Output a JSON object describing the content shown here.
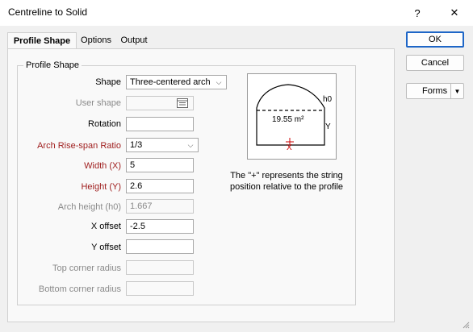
{
  "window": {
    "title": "Centreline to Solid",
    "help_icon": "?",
    "close_icon": "✕"
  },
  "tabs": [
    {
      "label": "Profile Shape"
    },
    {
      "label": "Options"
    },
    {
      "label": "Output"
    }
  ],
  "group": {
    "title": "Profile Shape"
  },
  "fields": {
    "shape": {
      "label": "Shape",
      "value": "Three-centered arch"
    },
    "user_shape": {
      "label": "User shape",
      "value": ""
    },
    "rotation": {
      "label": "Rotation",
      "value": ""
    },
    "arch_ratio": {
      "label": "Arch Rise-span Ratio",
      "value": "1/3"
    },
    "width": {
      "label": "Width (X)",
      "value": "5"
    },
    "height": {
      "label": "Height (Y)",
      "value": "2.6"
    },
    "arch_height": {
      "label": "Arch height (h0)",
      "value": "1.667"
    },
    "x_offset": {
      "label": "X offset",
      "value": "-2.5"
    },
    "y_offset": {
      "label": "Y offset",
      "value": ""
    },
    "top_radius": {
      "label": "Top corner radius",
      "value": ""
    },
    "bottom_radius": {
      "label": "Bottom corner radius",
      "value": ""
    }
  },
  "preview": {
    "area": "19.55 m²",
    "h0": "h0",
    "y": "Y",
    "x": "X"
  },
  "note": "The \"+\" represents the string position relative to the profile",
  "buttons": {
    "ok": "OK",
    "cancel": "Cancel",
    "forms": "Forms"
  },
  "colors": {
    "required_label": "#9e1b1b",
    "accent": "#1e66c7",
    "disabled_text": "#8a8a8a"
  }
}
